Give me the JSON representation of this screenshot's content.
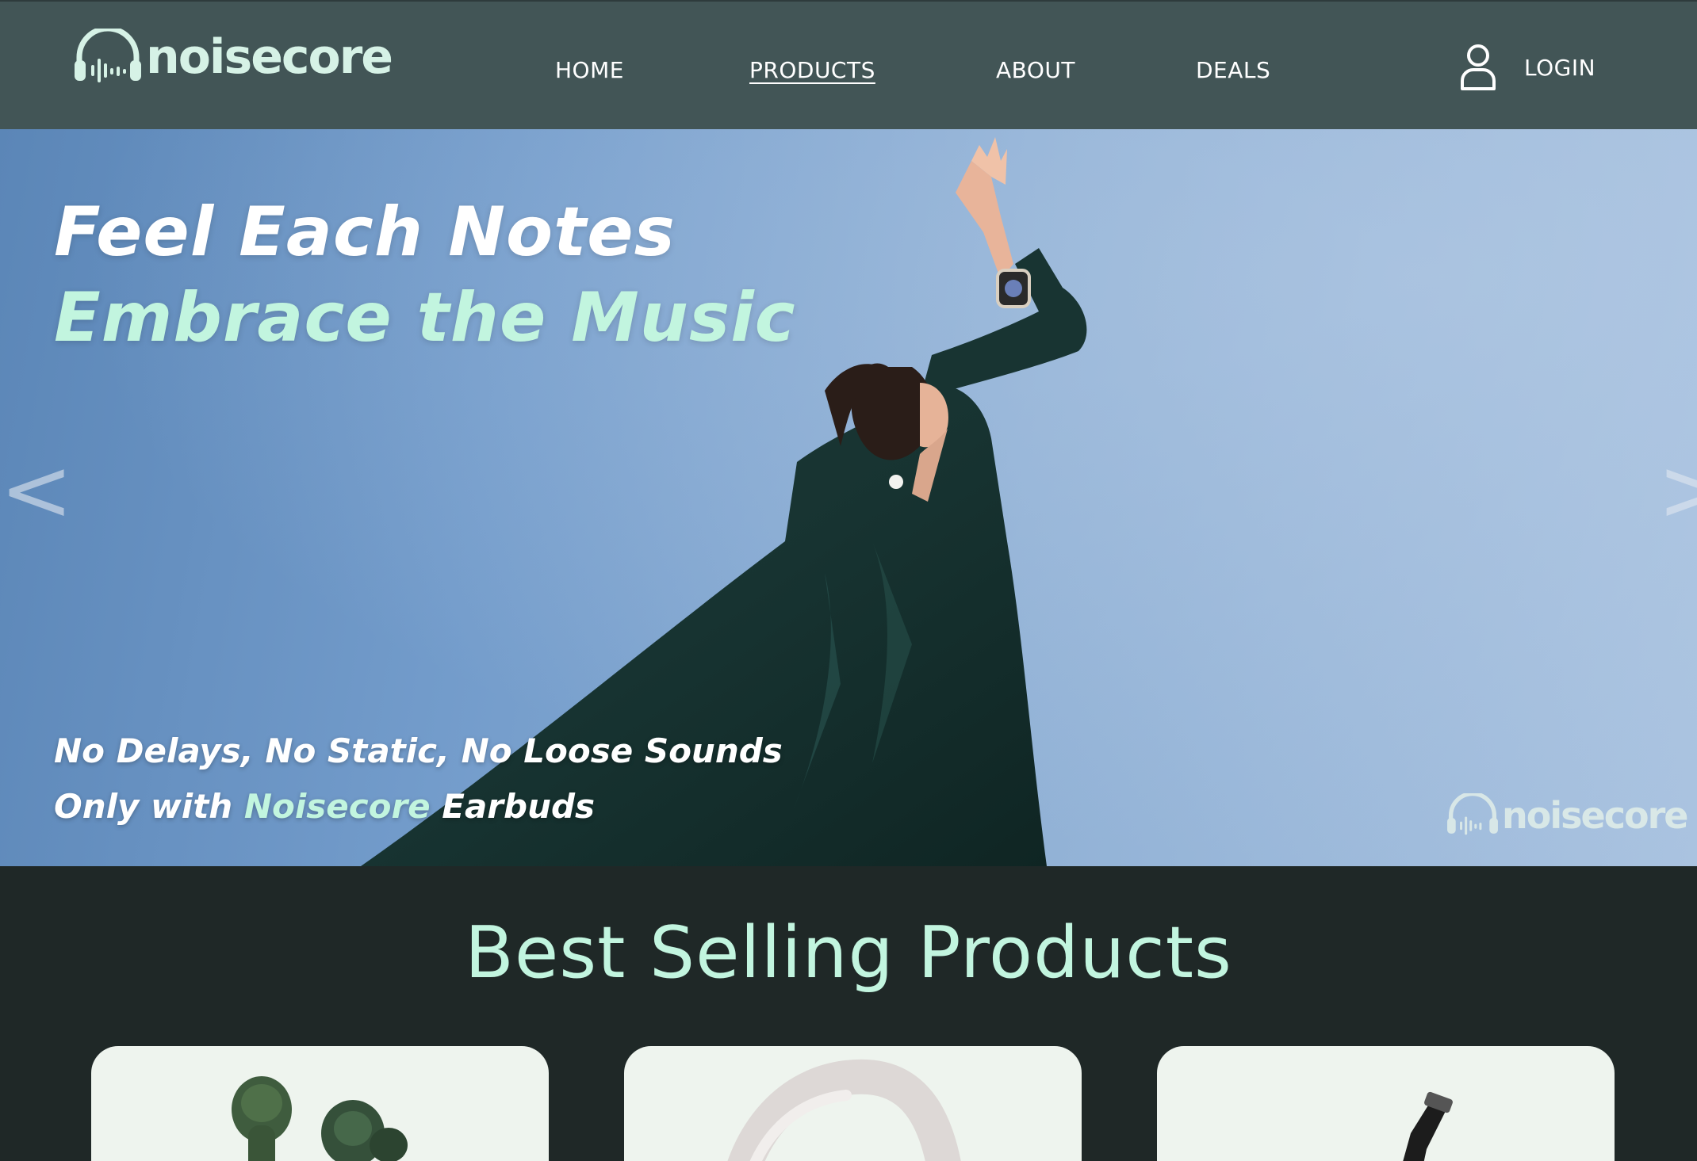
{
  "header": {
    "logo_text": "noisecore",
    "nav": [
      {
        "label": "HOME",
        "active": false
      },
      {
        "label": "PRODUCTS",
        "active": true
      },
      {
        "label": "ABOUT",
        "active": false
      },
      {
        "label": "DEALS",
        "active": false
      }
    ],
    "login_label": "LOGIN",
    "login_icon": "user-icon"
  },
  "hero": {
    "headline_1": "Feel Each Notes",
    "headline_2": "Embrace the Music",
    "sub_line_1": "No Delays, No Static, No Loose Sounds",
    "sub_line_2_prefix": "Only with ",
    "sub_line_2_brand": "Noisecore",
    "sub_line_2_suffix": " Earbuds",
    "prev_arrow": "<",
    "next_arrow": ">",
    "watermark_text": "noisecore"
  },
  "best_sellers": {
    "title": "Best Selling Products",
    "cards": [
      {
        "image": "green-earbuds"
      },
      {
        "image": "white-headphones"
      },
      {
        "image": "black-strap-product"
      }
    ]
  },
  "colors": {
    "header_bg": "#425556",
    "page_bg": "#1f2827",
    "accent_mint": "#c2f5df",
    "card_bg": "#eef4ee"
  }
}
